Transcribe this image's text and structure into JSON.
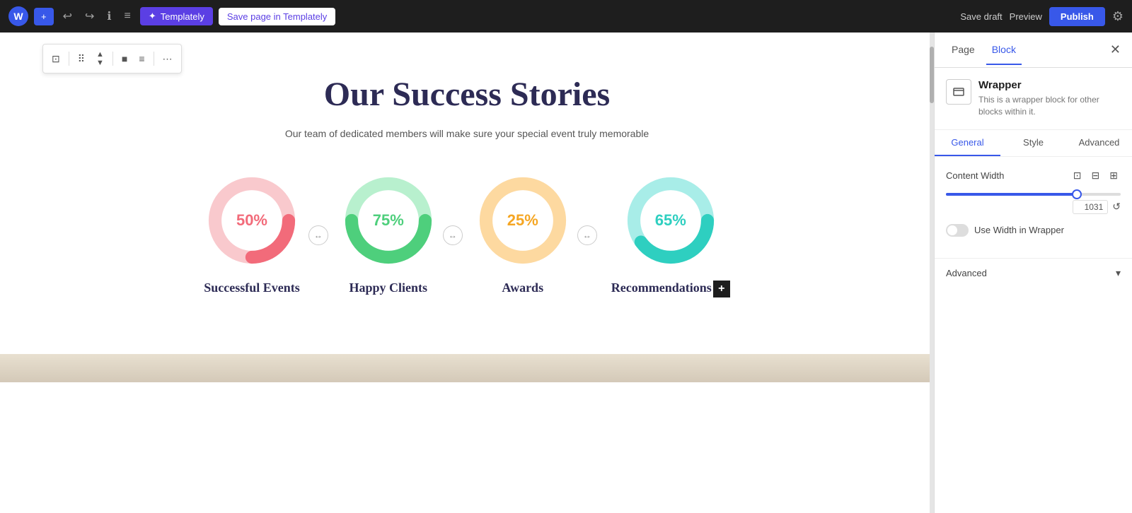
{
  "topbar": {
    "wp_logo": "W",
    "add_label": "+",
    "undo_label": "↩",
    "redo_label": "↪",
    "info_label": "ℹ",
    "list_label": "≡",
    "templately_label": "Templately",
    "save_templately_label": "Save page in Templately",
    "save_draft_label": "Save draft",
    "preview_label": "Preview",
    "publish_label": "Publish",
    "settings_label": "⚙"
  },
  "toolbar": {
    "icon1": "⊡",
    "icon2": "⠿",
    "icon3": "▲▼",
    "icon4": "■",
    "icon5": "≡",
    "icon6": "⋯"
  },
  "canvas": {
    "title": "Our Success Stories",
    "subtitle": "Our team of dedicated members will make sure your special event truly memorable"
  },
  "stats": [
    {
      "id": "successful-events",
      "percent": "50%",
      "label": "Successful Events",
      "color": "#f26b7a",
      "bg_color": "#f9c9cd",
      "pct": 50
    },
    {
      "id": "happy-clients",
      "percent": "75%",
      "label": "Happy Clients",
      "color": "#4ecf7c",
      "bg_color": "#b8f0ce",
      "pct": 75
    },
    {
      "id": "awards",
      "percent": "25%",
      "label": "Awards",
      "color": "#f5a623",
      "bg_color": "#fdd9a0",
      "pct": 25
    },
    {
      "id": "recommendations",
      "percent": "65%",
      "label": "Recommendations",
      "color": "#2ecfc0",
      "bg_color": "#a8ede8",
      "pct": 65
    }
  ],
  "sidebar": {
    "tab_page": "Page",
    "tab_block": "Block",
    "block_name": "Wrapper",
    "block_desc": "This is a wrapper block for other blocks within it.",
    "subtab_general": "General",
    "subtab_style": "Style",
    "subtab_advanced": "Advanced",
    "content_width_label": "Content Width",
    "slider_value": "1031",
    "use_width_label": "Use Width in Wrapper",
    "advanced_label": "Advanced"
  }
}
